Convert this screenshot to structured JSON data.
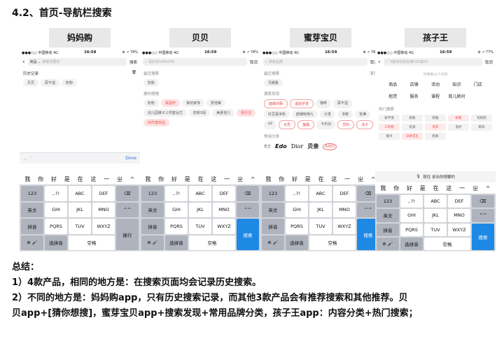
{
  "heading": "4.2、首页-导航栏搜索",
  "phones": [
    {
      "label": "妈妈购",
      "status": {
        "carrier": "●●●○○ 中国移动 4G",
        "time": "16:58",
        "battery": "⊕ ↗ 78%"
      },
      "search": {
        "scope": "商品 ⌄",
        "placeholder": "搜索您要的",
        "button": "搜索"
      },
      "history_title": "历史记录",
      "history_tags": [
        "贝贝",
        "尿不湿",
        "奶粉"
      ],
      "done": "Done"
    },
    {
      "label": "贝贝",
      "status": {
        "carrier": "●●●○○ 中国移动 4G",
        "time": "16:59",
        "battery": "⊕ ↗ 78%"
      },
      "search": {
        "placeholder": "找好货1956549",
        "button": "取消"
      },
      "history_title": "最近搜索",
      "history_tags": [
        "奶粉"
      ],
      "guess_title": "猜你想搜",
      "guess_tags": [
        {
          "text": "奶粉",
          "hot": false
        },
        {
          "text": "保温杯",
          "hot": true
        },
        {
          "text": "家纺家饰",
          "hot": false
        },
        {
          "text": "爱他美",
          "hot": false
        },
        {
          "text": "幼儿园裤子三件套合芯",
          "hot": false
        },
        {
          "text": "奶粉3段",
          "hot": false
        },
        {
          "text": "美素佳儿",
          "hot": false
        },
        {
          "text": "嬉乐宝",
          "hot": true
        },
        {
          "text": "四件套床品",
          "hot": true
        }
      ]
    },
    {
      "label": "蜜芽宝贝",
      "status": {
        "carrier": "●●●○○ 中国移动 4G",
        "time": "16:59",
        "battery": "⊕ ↗ 78%"
      },
      "search": {
        "placeholder": "搜索品牌",
        "button": "取消"
      },
      "recent_title": "最近搜索",
      "recent_clear": "清空",
      "recent_tags": [
        "贝朗夏"
      ],
      "discover_title": "搜索发现",
      "discover_tags": [
        {
          "text": "面霜衣服",
          "red": true
        },
        {
          "text": "温泉护发",
          "red": true
        },
        {
          "text": "咖啡",
          "red": false
        },
        {
          "text": "尿不湿",
          "red": false
        },
        {
          "text": "红豆薏米粉",
          "red": false
        },
        {
          "text": "欧姆哈特九",
          "red": false
        },
        {
          "text": "沙发",
          "red": false
        },
        {
          "text": "书架",
          "red": false
        },
        {
          "text": "安满",
          "red": false
        },
        {
          "text": "a2",
          "red": false
        },
        {
          "text": "水乳",
          "red": true
        },
        {
          "text": "面霜",
          "red": true
        },
        {
          "text": "卡乐比",
          "red": false
        },
        {
          "text": "饮料",
          "red": true
        },
        {
          "text": "凉子",
          "red": true
        }
      ],
      "brand_title": "常用分类",
      "brands": [
        "花王",
        "Edo",
        "Dior",
        "贝亲",
        "BABO"
      ]
    },
    {
      "label": "孩子王",
      "status": {
        "carrier": "●●●○○ 中国移动 4G",
        "time": "16:59",
        "battery": "⊕ ↗ 77%"
      },
      "search": {
        "placeholder": "飞鹤有机奶粉满200减25",
        "button": "取消"
      },
      "hint": "可搜索以下内容",
      "categories": [
        "商品",
        "店铺",
        "活动",
        "知识",
        "门店",
        "租赁",
        "服务",
        "课程",
        "育儿顾问"
      ],
      "hot_title": "热门搜索",
      "hot": [
        {
          "text": "尿不湿",
          "red": false
        },
        {
          "text": "奶粉",
          "red": false
        },
        {
          "text": "奶瓶",
          "red": false
        },
        {
          "text": "奶粉",
          "red": true
        },
        {
          "text": "玩的奶",
          "red": false
        },
        {
          "text": "三件套",
          "red": true
        },
        {
          "text": "玩具",
          "red": false
        },
        {
          "text": "内衣",
          "red": true
        },
        {
          "text": "洗护",
          "red": false
        },
        {
          "text": "雨伞",
          "red": false
        },
        {
          "text": "纸巾",
          "red": false
        },
        {
          "text": "日本花王",
          "red": true
        },
        {
          "text": "奶粉",
          "red": false
        }
      ],
      "voice": "按住 说出你想要的"
    }
  ],
  "keyboard": {
    "candidates": [
      "我",
      "你",
      "好",
      "是",
      "在",
      "这",
      "一",
      "ㄓ",
      "^"
    ],
    "rows": [
      [
        "123",
        ",.?!",
        "ABC",
        "DEF",
        "⌫"
      ],
      [
        "英文",
        "GHI",
        "JKL",
        "MNO",
        "^^"
      ],
      [
        "拼音",
        "PQRS",
        "TUV",
        "WXYZ"
      ],
      [
        "⊕",
        "🎤",
        "选拼音",
        "空格"
      ]
    ],
    "enter_default": "换行",
    "enter_search": "搜索"
  },
  "summary": {
    "title": "总结：",
    "line1": "1）4款产品，相同的地方是：在搜索页面均会记录历史搜索。",
    "line2": "2）不同的地方是：妈妈购app，只有历史搜索记录，而其他3款产品会有推荐搜索和其他推荐。贝",
    "line3": "贝app+[猜你想搜]，蜜芽宝贝app+搜索发现+常用品牌分类，孩子王app：内容分类+热门搜索；"
  }
}
